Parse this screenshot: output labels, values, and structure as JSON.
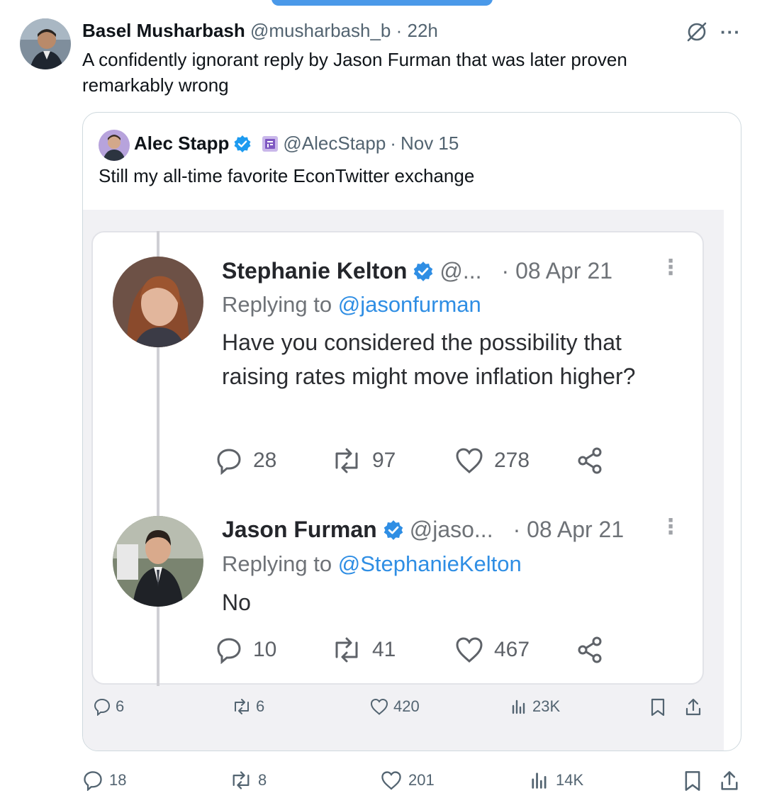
{
  "outer_tweet": {
    "name": "Basel Musharbash",
    "handle": "@musharbash_b",
    "separator": "·",
    "time": "22h",
    "text": "A confidently ignorant reply by Jason Furman that was later proven remarkably wrong",
    "actions": {
      "replies": "18",
      "reposts": "8",
      "likes": "201",
      "views": "14K"
    }
  },
  "quoted_tweet": {
    "name": "Alec Stapp",
    "handle": "@AlecStapp",
    "separator": "·",
    "date": "Nov 15",
    "text": "Still my all-time favorite EconTwitter exchange",
    "actions": {
      "replies": "6",
      "reposts": "6",
      "likes": "420",
      "views": "23K"
    }
  },
  "screenshot": {
    "tweets": [
      {
        "name": "Stephanie Kelton",
        "handle": "@...",
        "date": "· 08 Apr 21",
        "replying_prefix": "Replying to ",
        "replying_to": "@jasonfurman",
        "text": "Have you considered the possibility that raising rates might move inflation higher?",
        "replies": "28",
        "reposts": "97",
        "likes": "278"
      },
      {
        "name": "Jason Furman",
        "handle": "@jaso...",
        "date": "· 08 Apr 21",
        "replying_prefix": "Replying to ",
        "replying_to": "@StephanieKelton",
        "text": "No",
        "replies": "10",
        "reposts": "41",
        "likes": "467"
      }
    ]
  },
  "colors": {
    "verified": "#1d9bf0",
    "muted": "#536471",
    "mention": "#2f8ee4"
  }
}
